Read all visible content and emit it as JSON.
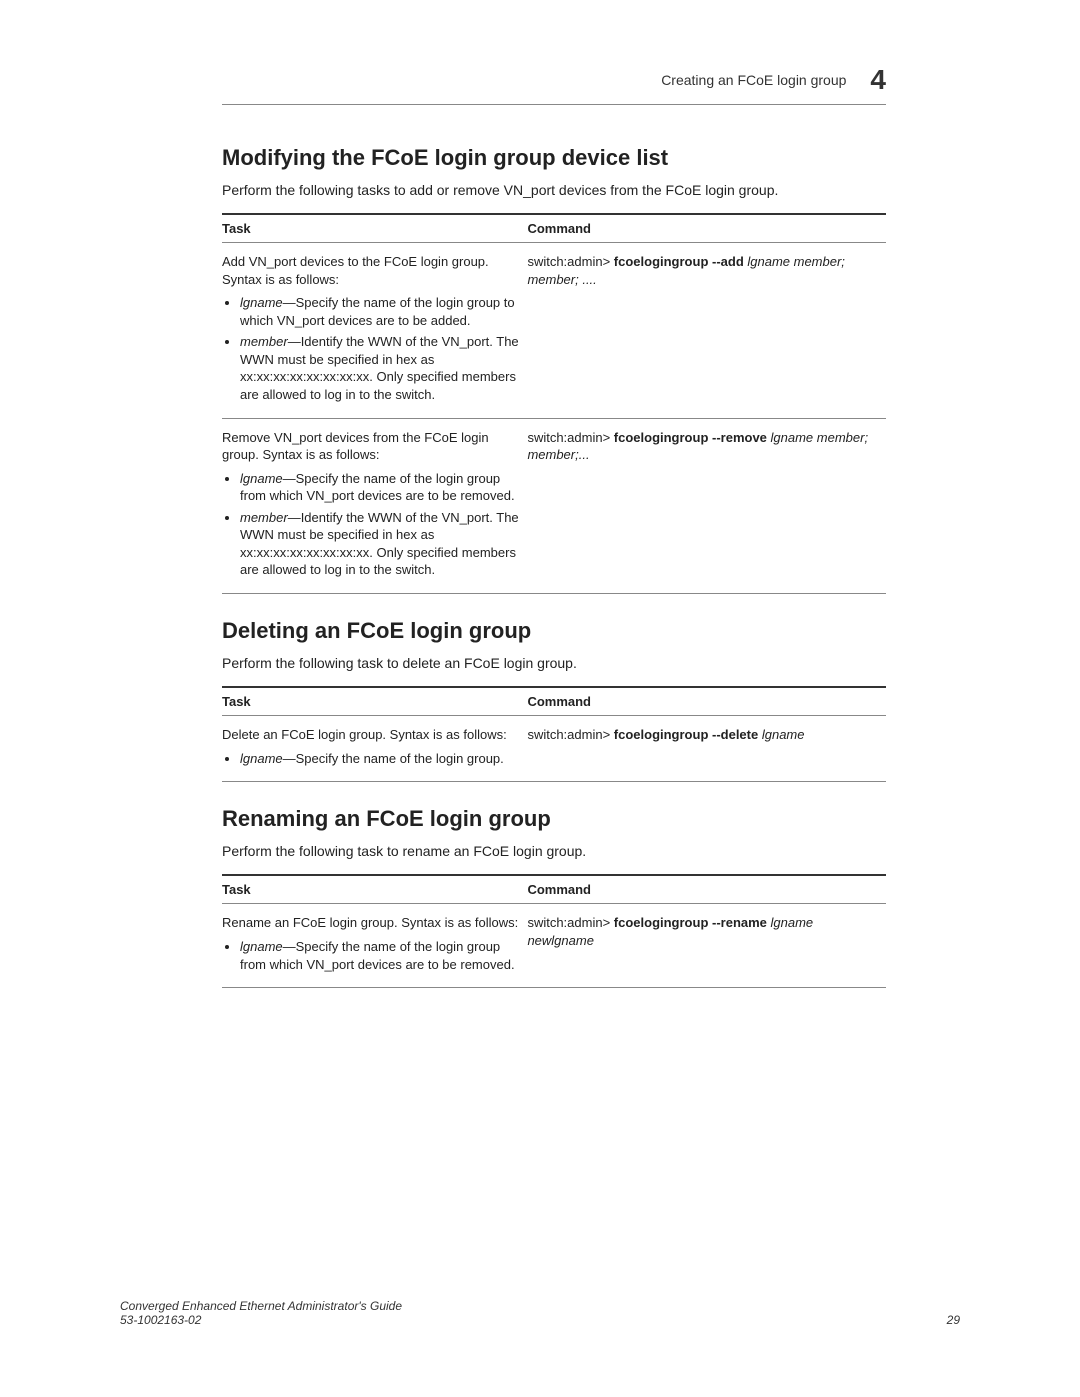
{
  "header": {
    "running_title": "Creating an FCoE login group",
    "chapter_number": "4"
  },
  "sections": {
    "modify": {
      "title": "Modifying the FCoE login group device list",
      "intro": "Perform the following tasks to add or remove VN_port devices from the FCoE login group.",
      "table": {
        "col_task": "Task",
        "col_cmd": "Command",
        "rows": [
          {
            "task_lead": "Add VN_port devices to the FCoE login group. Syntax is as follows:",
            "bullets": [
              {
                "term": "lgname",
                "desc": "—Specify the name of the login group to which VN_port devices are to be added."
              },
              {
                "term": "member",
                "desc": "—Identify the WWN of the VN_port. The WWN must be specified in hex as xx:xx:xx:xx:xx:xx:xx:xx. Only specified members are allowed to log in to the switch."
              }
            ],
            "cmd_prefix": "switch:admin> ",
            "cmd_bold": "fcoelogingroup --add",
            "cmd_tail_italic": " lgname member; member; ...."
          },
          {
            "task_lead": "Remove VN_port devices from the FCoE login group. Syntax is as follows:",
            "bullets": [
              {
                "term": "lgname",
                "desc": "—Specify the name of the login group from which VN_port devices are to be removed."
              },
              {
                "term": "member",
                "desc": "—Identify the WWN of the VN_port. The WWN must be specified in hex as xx:xx:xx:xx:xx:xx:xx:xx. Only specified members are allowed to log in to the switch."
              }
            ],
            "cmd_prefix": "switch:admin> ",
            "cmd_bold": "fcoelogingroup --remove",
            "cmd_tail_italic": " lgname member; member;..."
          }
        ]
      }
    },
    "delete": {
      "title": "Deleting an FCoE login group",
      "intro": "Perform the following task to delete an FCoE login group.",
      "table": {
        "col_task": "Task",
        "col_cmd": "Command",
        "rows": [
          {
            "task_lead": "Delete an FCoE login group. Syntax is as follows:",
            "bullets": [
              {
                "term": "lgname",
                "desc": "—Specify the name of the login group."
              }
            ],
            "cmd_prefix": "switch:admin> ",
            "cmd_bold": "fcoelogingroup --delete",
            "cmd_tail_italic": " lgname"
          }
        ]
      }
    },
    "rename": {
      "title": "Renaming an FCoE login group",
      "intro": "Perform the following task to rename an FCoE login group.",
      "table": {
        "col_task": "Task",
        "col_cmd": "Command",
        "rows": [
          {
            "task_lead": "Rename an FCoE login group. Syntax is as follows:",
            "bullets": [
              {
                "term": "lgname",
                "desc": "—Specify the name of the login group from which VN_port devices are to be removed."
              }
            ],
            "cmd_prefix": "switch:admin> ",
            "cmd_bold": "fcoelogingroup --rename",
            "cmd_tail_italic": " lgname newlgname"
          }
        ]
      }
    }
  },
  "footer": {
    "doc_title": "Converged Enhanced Ethernet Administrator's Guide",
    "doc_number": "53-1002163-02",
    "page": "29"
  }
}
